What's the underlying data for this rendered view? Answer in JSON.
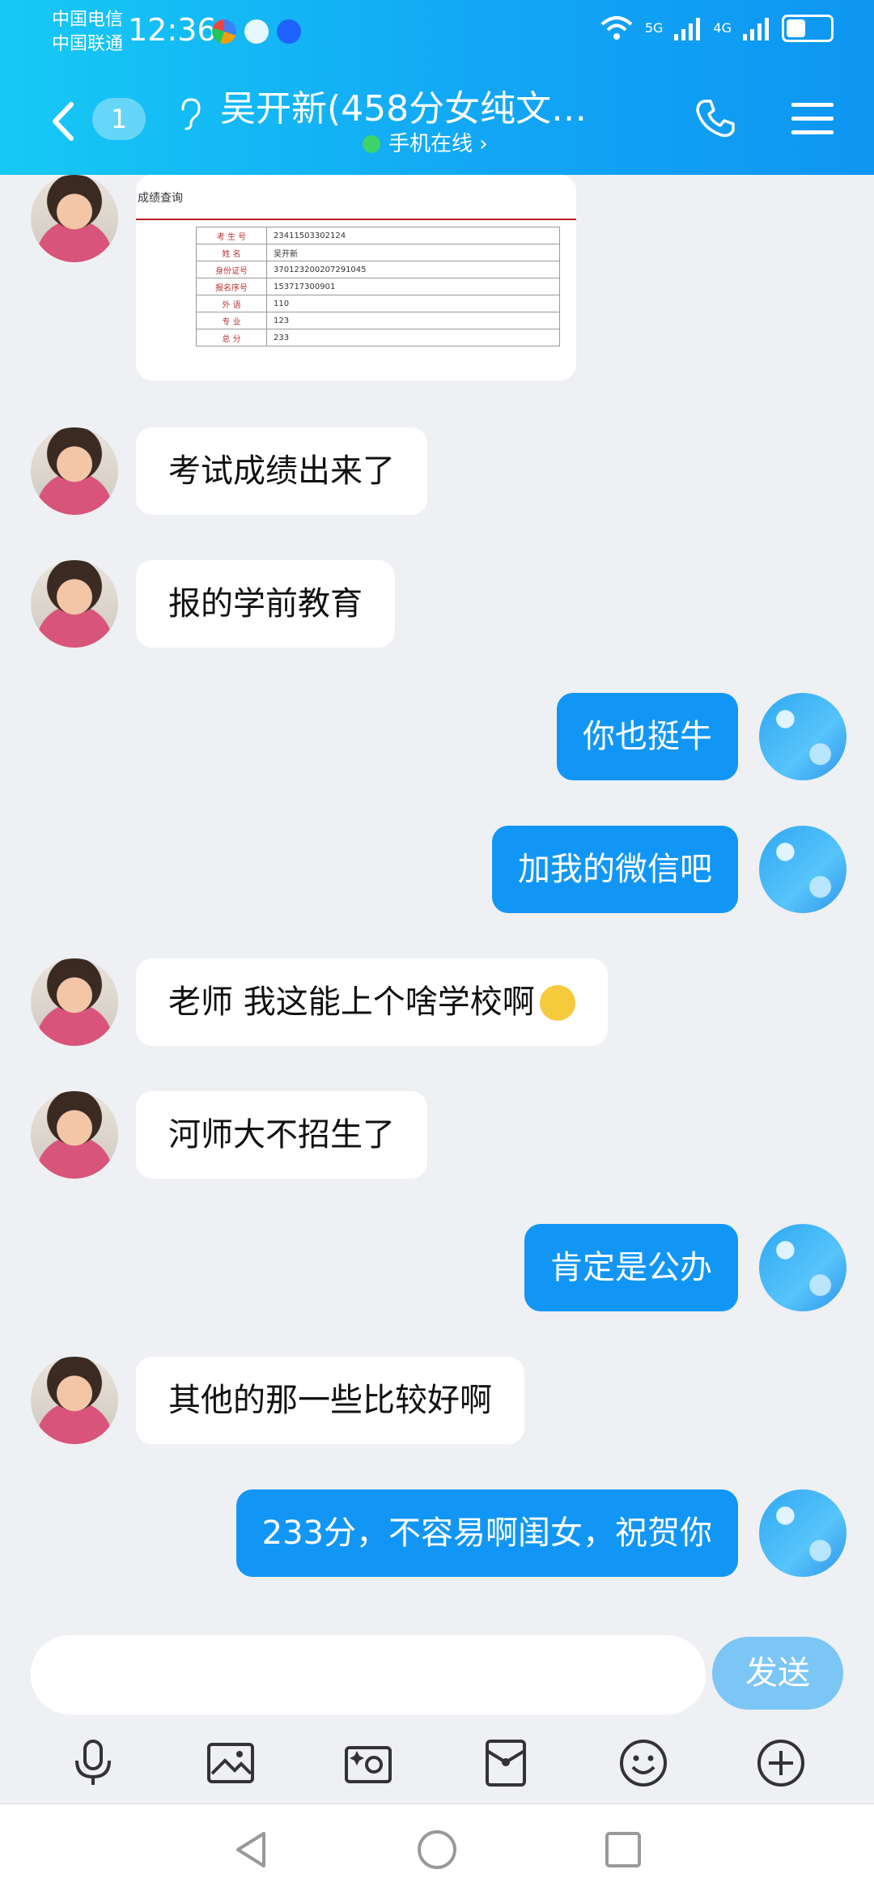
{
  "status_bar": {
    "carrier1": "中国电信",
    "carrier2": "中国联通",
    "time": "12:36",
    "net1": "5G",
    "net2": "4G"
  },
  "header": {
    "back_badge": "1",
    "title": "吴开新(458分女纯文…",
    "subtitle": "手机在线 ›"
  },
  "score_image": {
    "page_title": "成绩查询",
    "rows": [
      {
        "k": "考 生 号",
        "v": "23411503302124"
      },
      {
        "k": "姓  名",
        "v": "吴开新"
      },
      {
        "k": "身份证号",
        "v": "370123200207291045"
      },
      {
        "k": "报名序号",
        "v": "153717300901"
      },
      {
        "k": "外  语",
        "v": "110"
      },
      {
        "k": "专  业",
        "v": "123"
      },
      {
        "k": "总  分",
        "v": "233"
      }
    ]
  },
  "messages": [
    {
      "side": "in",
      "text": "考试成绩出来了"
    },
    {
      "side": "in",
      "text": "报的学前教育"
    },
    {
      "side": "out",
      "text": "你也挺牛"
    },
    {
      "side": "out",
      "text": "加我的微信吧"
    },
    {
      "side": "in",
      "text": "老师 我这能上个啥学校啊"
    },
    {
      "side": "in",
      "text": "河师大不招生了"
    },
    {
      "side": "out",
      "text": "肯定是公办"
    },
    {
      "side": "in",
      "text": "其他的那一些比较好啊"
    },
    {
      "side": "out",
      "text": "233分，不容易啊闺女，祝贺你"
    }
  ],
  "input": {
    "placeholder": "",
    "value": ""
  },
  "send_label": "发送",
  "colors": {
    "accent": "#1296f5",
    "header_start": "#16c9f5",
    "send_disabled": "#7cc6f6"
  },
  "toolbar_icons": [
    "mic-icon",
    "image-icon",
    "camera-icon",
    "red-envelope-icon",
    "emoji-icon",
    "plus-icon"
  ],
  "battery_level": 0.45
}
